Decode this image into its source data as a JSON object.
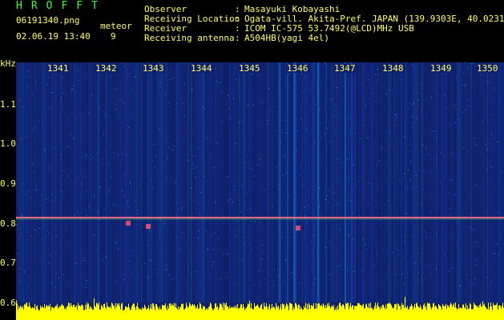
{
  "header": {
    "logo": "HROFFT",
    "filename": "06191340.png",
    "datetime": "02.06.19 13:40",
    "mode_label": "meteor",
    "count": "9",
    "fields": [
      {
        "label": "Observer",
        "value": "Masayuki Kobayashi"
      },
      {
        "label": "Receiving Location",
        "value": "Ogata-vill. Akita-Pref. JAPAN (139.9303E, 40.0231N)"
      },
      {
        "label": "Receiver",
        "value": "ICOM IC-575 53.7492(@LCD)MHz USB"
      },
      {
        "label": "Receiving antenna",
        "value": "A504HB(yagi 4el)"
      }
    ],
    "separator": ":"
  },
  "axes": {
    "y_unit": "kHz",
    "y_ticks": [
      "1.1",
      "1.0",
      "0.9",
      "0.8",
      "0.7",
      "0.6"
    ],
    "x_ticks": [
      "1341",
      "1342",
      "1343",
      "1344",
      "1345",
      "1346",
      "1347",
      "1348",
      "1349",
      "1350"
    ]
  },
  "colors": {
    "background": "#000000",
    "text": "#ffff66",
    "logo": "#33ff33",
    "spectrum_base": "#10206a",
    "carrier_line": "#d04060",
    "bottom_bar": "#ffff00"
  }
}
